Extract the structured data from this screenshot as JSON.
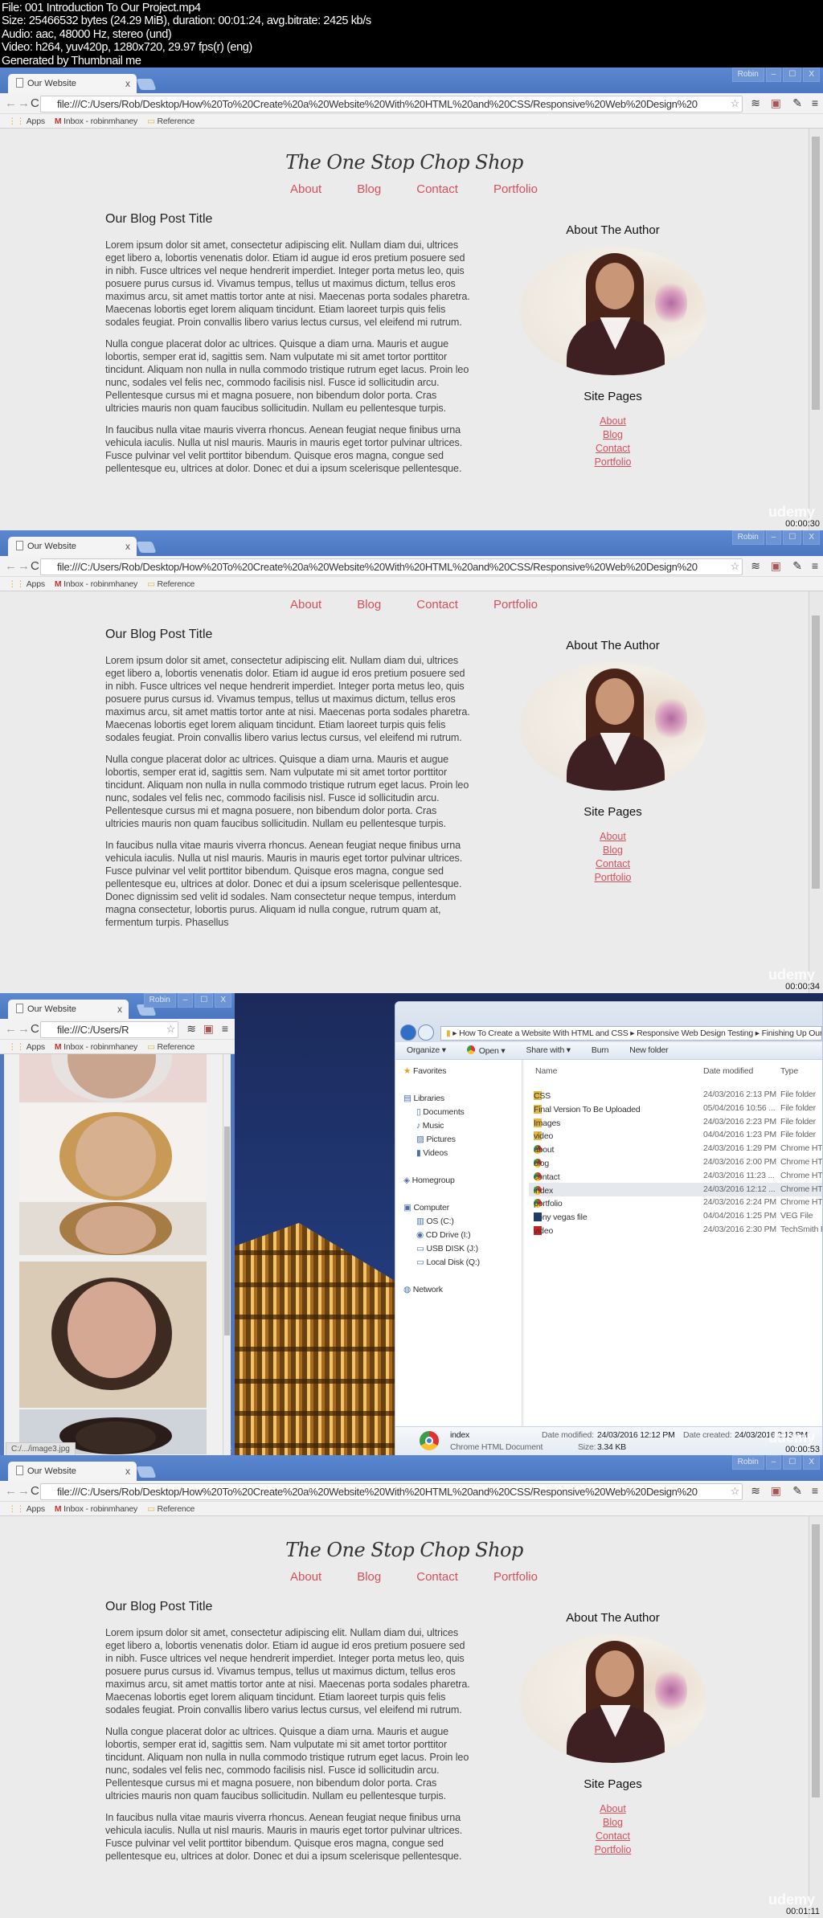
{
  "header": {
    "lines": [
      "File: 001 Introduction To Our Project.mp4",
      "Size: 25466532 bytes (24.29 MiB), duration: 00:01:24, avg.bitrate: 2425 kb/s",
      "Audio: aac, 48000 Hz, stereo (und)",
      "Video: h264, yuv420p, 1280x720, 29.97 fps(r) (eng)",
      "Generated by Thumbnail me"
    ]
  },
  "browser": {
    "tab_title": "Our Website",
    "tab_close": "x",
    "user": "Robin",
    "window_controls": [
      "–",
      "☐",
      "X"
    ],
    "url": "file:///C:/Users/Rob/Desktop/How%20To%20Create%20a%20Website%20With%20HTML%20and%20CSS/Responsive%20Web%20Design%20",
    "url_short": "file:///C:/Users/R",
    "bookmarks": [
      "Apps",
      "Inbox - robinmhaney",
      "Reference"
    ],
    "icons": [
      "back-icon",
      "forward-icon",
      "reload-icon",
      "star-icon",
      "buffer-icon",
      "instagram-icon",
      "eyedropper-icon",
      "menu-icon"
    ]
  },
  "website": {
    "title": "The One Stop Chop Shop",
    "nav": [
      "About",
      "Blog",
      "Contact",
      "Portfolio"
    ],
    "post_title": "Our Blog Post Title",
    "paragraphs": [
      "Lorem ipsum dolor sit amet, consectetur adipiscing elit. Nullam diam dui, ultrices eget libero a, lobortis venenatis dolor. Etiam id augue id eros pretium posuere sed in nibh. Fusce ultrices vel neque hendrerit imperdiet. Integer porta metus leo, quis posuere purus cursus id. Vivamus tempus, tellus ut maximus dictum, tellus eros maximus arcu, sit amet mattis tortor ante at nisi. Maecenas porta sodales pharetra. Maecenas lobortis eget lorem aliquam tincidunt. Etiam laoreet turpis quis felis sodales feugiat. Proin convallis libero varius lectus cursus, vel eleifend mi rutrum.",
      "Nulla congue placerat dolor ac ultrices. Quisque a diam urna. Mauris et augue lobortis, semper erat id, sagittis sem. Nam vulputate mi sit amet tortor porttitor tincidunt. Aliquam non nulla in nulla commodo tristique rutrum eget lacus. Proin leo nunc, sodales vel felis nec, commodo facilisis nisl. Fusce id sollicitudin arcu. Pellentesque cursus mi et magna posuere, non bibendum dolor porta. Cras ultricies mauris non quam faucibus sollicitudin. Nullam eu pellentesque turpis.",
      "In faucibus nulla vitae mauris viverra rhoncus. Aenean feugiat neque finibus urna vehicula iaculis. Nulla ut nisl mauris. Mauris in mauris eget tortor pulvinar ultrices. Fusce pulvinar vel velit porttitor bibendum. Quisque eros magna, congue sed pellentesque eu, ultrices at dolor. Donec et dui a ipsum scelerisque pellentesque. Donec dignissim sed velit id sodales. Nam consectetur neque tempus, interdum magna consectetur, lobortis purus. Aliquam id nulla congue, rutrum quam at, fermentum turpis. Phasellus"
    ],
    "aside_author": "About The Author",
    "aside_pages": "Site Pages",
    "aside_links": [
      "About",
      "Blog",
      "Contact",
      "Portfolio"
    ],
    "accent": "#d6505c"
  },
  "frames": [
    {
      "timestamp": "00:00:30",
      "watermark": "udemy"
    },
    {
      "timestamp": "00:00:34",
      "watermark": "udemy"
    },
    {
      "timestamp": "00:00:53",
      "watermark": "udemy",
      "status_url": "C:/.../image3.jpg"
    },
    {
      "timestamp": "00:01:11",
      "watermark": "udemy"
    }
  ],
  "explorer": {
    "breadcrumb": [
      "How To Create a Website With HTML and CSS",
      "Responsive Web Design Testing",
      "Finishing Up Our"
    ],
    "toolbar": [
      "Organize ▾",
      "Open ▾",
      "Share with ▾",
      "Burn",
      "New folder"
    ],
    "nav_pane": [
      "Favorites",
      "Libraries",
      "Documents",
      "Music",
      "Pictures",
      "Videos",
      "Homegroup",
      "Computer",
      "OS (C:)",
      "CD Drive (I:)",
      "USB DISK (J:)",
      "Local Disk (Q:)",
      "Network"
    ],
    "columns": [
      "Name",
      "Date modified",
      "Type"
    ],
    "files": [
      {
        "name": "CSS",
        "date": "24/03/2016 2:13 PM",
        "type": "File folder",
        "icon": "folder"
      },
      {
        "name": "Final Version To Be Uploaded",
        "date": "05/04/2016 10:56 ...",
        "type": "File folder",
        "icon": "folder"
      },
      {
        "name": "Images",
        "date": "24/03/2016 2:23 PM",
        "type": "File folder",
        "icon": "folder"
      },
      {
        "name": "video",
        "date": "04/04/2016 1:23 PM",
        "type": "File folder",
        "icon": "folder"
      },
      {
        "name": "about",
        "date": "24/03/2016 1:29 PM",
        "type": "Chrome HTM",
        "icon": "chrome"
      },
      {
        "name": "blog",
        "date": "24/03/2016 2:00 PM",
        "type": "Chrome HTM",
        "icon": "chrome"
      },
      {
        "name": "contact",
        "date": "24/03/2016 11:23 ...",
        "type": "Chrome HTM",
        "icon": "chrome"
      },
      {
        "name": "index",
        "date": "24/03/2016 12:12 ...",
        "type": "Chrome HTM",
        "icon": "chrome",
        "selected": true
      },
      {
        "name": "portfolio",
        "date": "24/03/2016 2:24 PM",
        "type": "Chrome HTM",
        "icon": "chrome"
      },
      {
        "name": "sony vegas file",
        "date": "04/04/2016 1:25 PM",
        "type": "VEG File",
        "icon": "veg"
      },
      {
        "name": "video",
        "date": "24/03/2016 2:30 PM",
        "type": "TechSmith R",
        "icon": "vid"
      }
    ],
    "details": {
      "name": "index",
      "kind": "Chrome HTML Document",
      "modified_label": "Date modified:",
      "modified": "24/03/2016 12:12 PM",
      "created_label": "Date created:",
      "created": "24/03/2016 2:13 PM",
      "size_label": "Size:",
      "size": "3.34 KB"
    }
  }
}
